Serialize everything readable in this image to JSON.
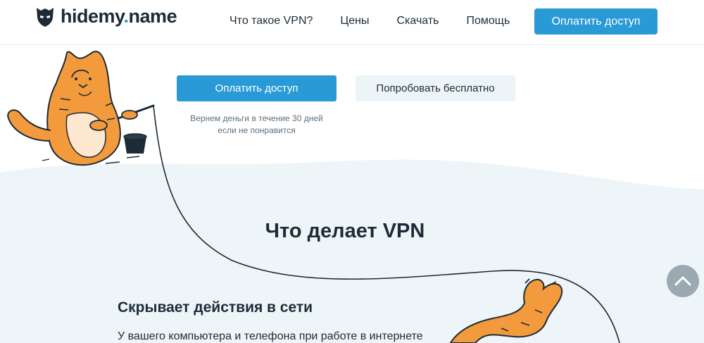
{
  "header": {
    "logo_text_main": "hidemy",
    "logo_text_dot": ".",
    "logo_text_end": "name",
    "logo_icon": "shield-mask-icon",
    "nav": [
      {
        "label": "Что такое VPN?"
      },
      {
        "label": "Цены"
      },
      {
        "label": "Скачать"
      },
      {
        "label": "Помощь"
      }
    ],
    "cta_label": "Оплатить доступ"
  },
  "hero": {
    "pay_label": "Оплатить доступ",
    "try_label": "Попробовать бесплатно",
    "refund_line1": "Вернем деньги в течение 30 дней",
    "refund_line2": "если не понравится"
  },
  "section": {
    "title": "Что делает VPN",
    "feature_title": "Скрывает действия в сети",
    "feature_text": "У вашего компьютера и телефона при работе в интернете"
  },
  "colors": {
    "accent": "#2a9ad6",
    "section_bg": "#eef5f9",
    "cat_orange": "#f39a3d",
    "text": "#1d2b36"
  },
  "scroll_top_icon": "chevron-up-icon"
}
